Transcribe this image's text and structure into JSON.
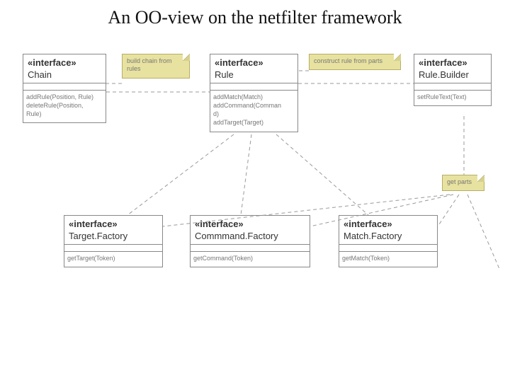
{
  "title": "An OO-view on the netfilter framework",
  "classes": {
    "chain": {
      "stereotype": "«interface»",
      "name": "Chain",
      "operations": "addRule(Position, Rule)\ndeleteRule(Position,\nRule)"
    },
    "rule": {
      "stereotype": "«interface»",
      "name": "Rule",
      "operations": "addMatch(Match)\naddCommand(Comman\nd)\naddTarget(Target)"
    },
    "ruleBuilder": {
      "stereotype": "«interface»",
      "name": "Rule.Builder",
      "operations": "setRuleText(Text)"
    },
    "targetFactory": {
      "stereotype": "«interface»",
      "name": "Target.Factory",
      "operations": "getTarget(Token)"
    },
    "commandFactory": {
      "stereotype": "«interface»",
      "name": "Commmand.Factory",
      "operations": "getCommand(Token)"
    },
    "matchFactory": {
      "stereotype": "«interface»",
      "name": "Match.Factory",
      "operations": "getMatch(Token)"
    }
  },
  "notes": {
    "buildChain": "build chain from\nrules",
    "constructRule": "construct rule from parts",
    "getParts": "get parts"
  }
}
